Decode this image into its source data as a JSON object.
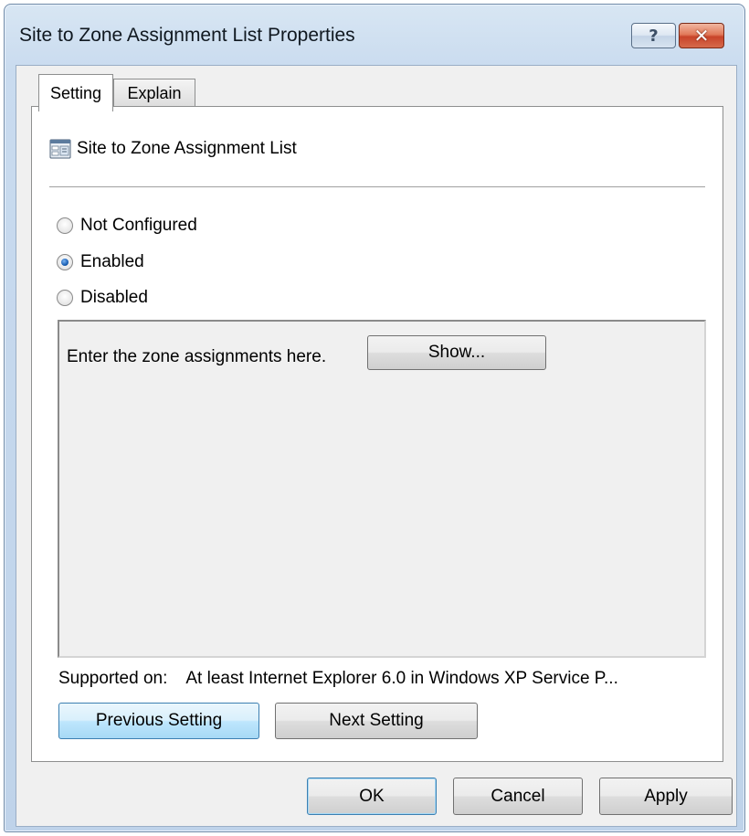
{
  "window": {
    "title": "Site to Zone Assignment List Properties",
    "help_glyph": "?",
    "close_glyph": "✕"
  },
  "tabs": [
    {
      "label": "Setting",
      "selected": true
    },
    {
      "label": "Explain",
      "selected": false
    }
  ],
  "setting": {
    "policy_name": "Site to Zone Assignment List",
    "policy_icon": "policy-setting-icon",
    "radio_options": [
      {
        "label": "Not Configured",
        "checked": false
      },
      {
        "label": "Enabled",
        "checked": true
      },
      {
        "label": "Disabled",
        "checked": false
      }
    ],
    "options": {
      "label": "Enter the zone assignments here.",
      "show_button": "Show..."
    },
    "supported_on_label": "Supported on:",
    "supported_on_value": "At least Internet Explorer 6.0 in Windows XP Service P...",
    "previous_button": "Previous Setting",
    "next_button": "Next Setting"
  },
  "footer": {
    "ok": "OK",
    "cancel": "Cancel",
    "apply": "Apply"
  },
  "colors": {
    "frame": "#c9dbef",
    "close_button": "#c8442a",
    "focus_button": "#3c7fb1"
  }
}
